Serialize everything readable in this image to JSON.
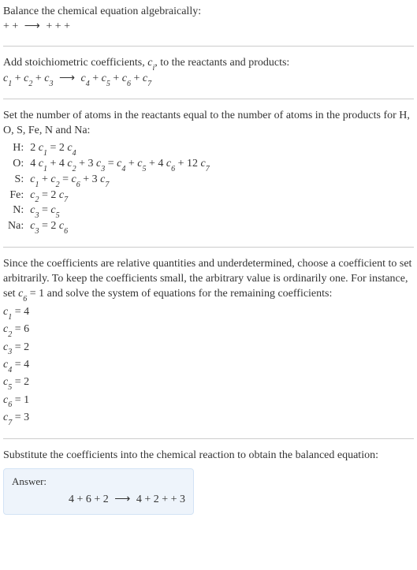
{
  "step1": {
    "text": "Balance the chemical equation algebraically:",
    "lhs_plus": "+ +",
    "arrow": "⟶",
    "rhs_plus": "+ + +"
  },
  "step2": {
    "intro_before_ci": "Add stoichiometric coefficients, ",
    "ci_c": "c",
    "ci_i": "i",
    "intro_after_ci": ", to the reactants and products:",
    "eq": {
      "arrow": "⟶"
    }
  },
  "step3": {
    "text": "Set the number of atoms in the reactants equal to the number of atoms in the products for H, O, S, Fe, N and Na:"
  },
  "step4": {
    "p1": "Since the coefficients are relative quantities and underdetermined, choose a coefficient to set arbitrarily. To keep the coefficients small, the arbitrary value is ordinarily one. For instance, set ",
    "c6c": "c",
    "c6n": "6",
    "p2": " = 1 and solve the system of equations for the remaining coefficients:"
  },
  "coeff": {
    "c1": {
      "c": "c",
      "n": "1",
      "eq": " = 4"
    },
    "c2": {
      "c": "c",
      "n": "2",
      "eq": " = 6"
    },
    "c3": {
      "c": "c",
      "n": "3",
      "eq": " = 2"
    },
    "c4": {
      "c": "c",
      "n": "4",
      "eq": " = 4"
    },
    "c5": {
      "c": "c",
      "n": "5",
      "eq": " = 2"
    },
    "c6": {
      "c": "c",
      "n": "6",
      "eq": " = 1"
    },
    "c7": {
      "c": "c",
      "n": "7",
      "eq": " = 3"
    }
  },
  "step5": {
    "text": "Substitute the coefficients into the chemical reaction to obtain the balanced equation:"
  },
  "answer": {
    "label": "Answer:",
    "lhs": "4  + 6  + 2 ",
    "arrow": "⟶",
    "rhs": " 4  + 2  +  + 3 "
  },
  "chart_data": {
    "type": "table",
    "title": "Atom balance equations and solved coefficients",
    "atom_balance": [
      {
        "element": "H",
        "equation": "2 c1 = 2 c4"
      },
      {
        "element": "O",
        "equation": "4 c1 + 4 c2 + 3 c3 = c4 + c5 + 4 c6 + 12 c7"
      },
      {
        "element": "S",
        "equation": "c1 + c2 = c6 + 3 c7"
      },
      {
        "element": "Fe",
        "equation": "c2 = 2 c7"
      },
      {
        "element": "N",
        "equation": "c3 = c5"
      },
      {
        "element": "Na",
        "equation": "c3 = 2 c6"
      }
    ],
    "coefficients": {
      "c1": 4,
      "c2": 6,
      "c3": 2,
      "c4": 4,
      "c5": 2,
      "c6": 1,
      "c7": 3
    },
    "general_reaction": "c1 + c2 + c3 ⟶ c4 + c5 + c6 + c7",
    "balanced_display": "4 + 6 + 2 ⟶ 4 + 2 + + 3"
  },
  "atoms": {
    "H": {
      "el": "H:"
    },
    "O": {
      "el": "O:"
    },
    "S": {
      "el": "S:"
    },
    "Fe": {
      "el": "Fe:"
    },
    "N": {
      "el": "N:"
    },
    "Na": {
      "el": "Na:"
    }
  },
  "sym": {
    "c": "c",
    "n1": "1",
    "n2": "2",
    "n3": "3",
    "n4": "4",
    "n5": "5",
    "n6": "6",
    "n7": "7",
    "two": "2 ",
    "three": "3 ",
    "four": "4 ",
    "twelve": "12 ",
    "eq": " = ",
    "plus": " + "
  }
}
